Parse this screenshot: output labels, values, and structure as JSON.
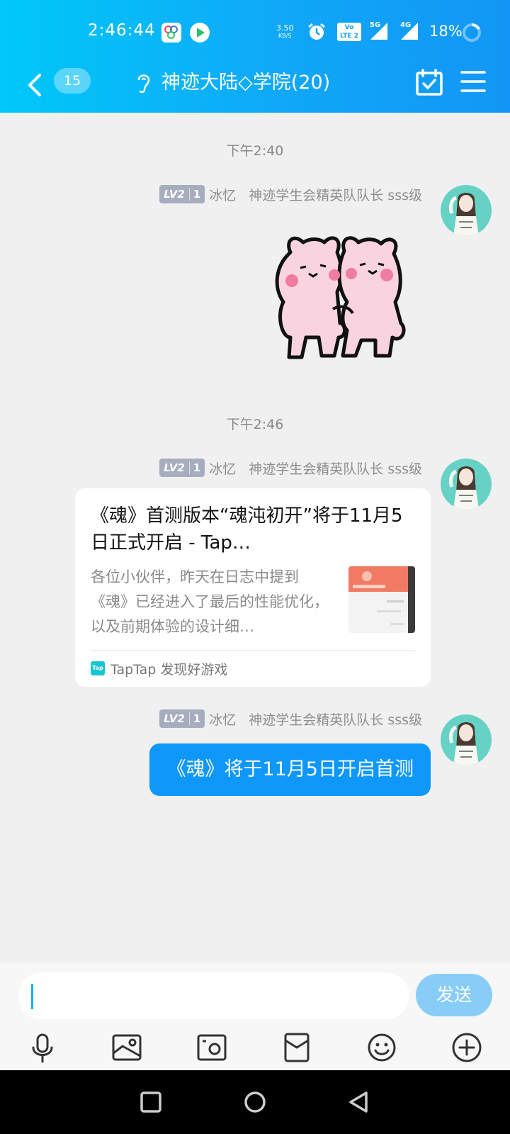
{
  "status_bar": {
    "time": "2:46:44",
    "net_speed_value": "3.50",
    "net_speed_unit": "KB/S",
    "volte_top": "Vo",
    "volte_bottom": "LTE 2",
    "sim1_label": "5G",
    "sim2_label": "4G",
    "battery": "18%"
  },
  "header": {
    "unread_count": "15",
    "title": "神迹大陆◇学院(20)"
  },
  "messages": [
    {
      "timestamp": "下午2:40",
      "sender": {
        "level": "LV2",
        "level_num": "1",
        "name": "冰忆",
        "title": "神迹学生会精英队队长 sss级"
      }
    },
    {
      "timestamp": "下午2:46",
      "sender": {
        "level": "LV2",
        "level_num": "1",
        "name": "冰忆",
        "title": "神迹学生会精英队队长 sss级"
      },
      "card": {
        "title": "《魂》首测版本“魂沌初开”将于11月5日正式开启 - Tap…",
        "description": "各位小伙伴，昨天在日志中提到《魂》已经进入了最后的性能优化，以及前期体验的设计细…",
        "source": "TapTap 发现好游戏",
        "source_logo": "Tap"
      }
    },
    {
      "sender": {
        "level": "LV2",
        "level_num": "1",
        "name": "冰忆",
        "title": "神迹学生会精英队队长 sss级"
      },
      "text": "《魂》将于11月5日开启首测"
    }
  ],
  "input": {
    "value": "",
    "send_label": "发送"
  },
  "colors": {
    "header_gradient_start": "#00c8f8",
    "header_gradient_end": "#1296f5",
    "bubble": "#0f98fa",
    "send_button": "#88cdf8"
  },
  "toolbar_icons": [
    "microphone-icon",
    "image-icon",
    "camera-icon",
    "red-packet-icon",
    "emoji-icon",
    "plus-icon"
  ]
}
